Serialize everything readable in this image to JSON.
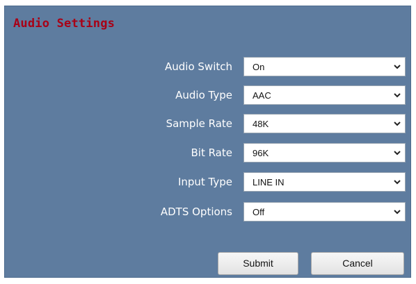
{
  "title": "Audio Settings",
  "fields": [
    {
      "label": "Audio Switch",
      "value": "On"
    },
    {
      "label": "Audio Type",
      "value": "AAC"
    },
    {
      "label": "Sample Rate",
      "value": "48K"
    },
    {
      "label": "Bit Rate",
      "value": "96K"
    },
    {
      "label": "Input Type",
      "value": "LINE IN"
    },
    {
      "label": "ADTS Options",
      "value": "Off"
    }
  ],
  "buttons": {
    "submit": "Submit",
    "cancel": "Cancel"
  },
  "icons": {
    "dropdown": "chevron-down-icon"
  },
  "colors": {
    "panel_background": "#5e7c9f",
    "title_text": "#a80016",
    "label_text": "#ffffff"
  }
}
